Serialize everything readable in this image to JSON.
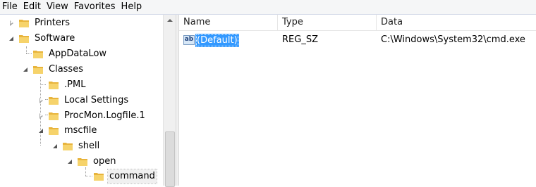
{
  "menu": [
    "File",
    "Edit",
    "View",
    "Favorites",
    "Help"
  ],
  "tree": {
    "nodes": [
      {
        "label": "Printers",
        "expander": "collapsed"
      },
      {
        "label": "Software",
        "expander": "expanded"
      },
      {
        "label": "AppDataLow",
        "expander": "none"
      },
      {
        "label": "Classes",
        "expander": "expanded"
      },
      {
        "label": ".PML",
        "expander": "none"
      },
      {
        "label": "Local Settings",
        "expander": "collapsed"
      },
      {
        "label": "ProcMon.Logfile.1",
        "expander": "collapsed"
      },
      {
        "label": "mscfile",
        "expander": "expanded"
      },
      {
        "label": "shell",
        "expander": "expanded"
      },
      {
        "label": "open",
        "expander": "expanded"
      },
      {
        "label": "command",
        "expander": "none",
        "selected": true
      }
    ]
  },
  "list": {
    "columns": [
      "Name",
      "Type",
      "Data"
    ],
    "rows": [
      {
        "icon": "reg-string-icon",
        "icon_text": "ab",
        "name": "(Default)",
        "type": "REG_SZ",
        "data": "C:\\Windows\\System32\\cmd.exe",
        "selected": true
      }
    ]
  },
  "colors": {
    "selection": "#3399ff",
    "folder": "#e8b43c"
  }
}
